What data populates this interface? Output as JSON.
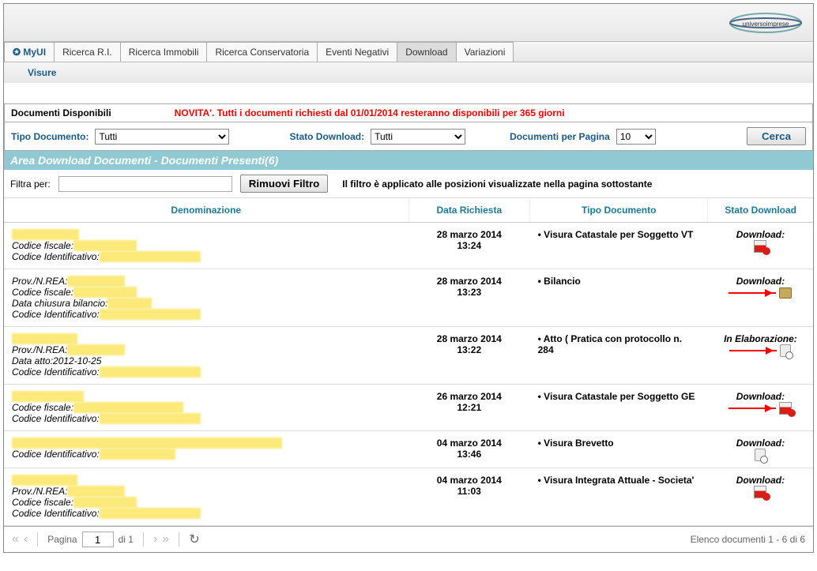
{
  "logo_text": "universoimprese",
  "tabs": [
    "MyUI",
    "Ricerca R.I.",
    "Ricerca Immobili",
    "Ricerca Conservatoria",
    "Eventi Negativi",
    "Download",
    "Variazioni"
  ],
  "active_tab_index": 5,
  "subtab": "Visure",
  "section_title": "Documenti Disponibili",
  "notice": "NOVITA'. Tutti i documenti richiesti dal 01/01/2014 resteranno disponibili per 365 giorni",
  "filters": {
    "tipo_label": "Tipo Documento:",
    "tipo_value": "Tutti",
    "stato_label": "Stato Download:",
    "stato_value": "Tutti",
    "perpage_label": "Documenti per Pagina",
    "perpage_value": "10",
    "search_btn": "Cerca"
  },
  "area_header": "Area Download Documenti - Documenti Presenti(6)",
  "filter_bar": {
    "label": "Filtra per:",
    "remove_btn": "Rimuovi Filtro",
    "note": "Il filtro è applicato alle posizioni visualizzate nella pagina sottostante"
  },
  "columns": {
    "denom": "Denominazione",
    "date": "Data Richiesta",
    "tipo": "Tipo Documento",
    "stato": "Stato Download"
  },
  "rows": [
    {
      "lines": [
        {
          "redact": "XXXXXX X.X.X."
        },
        {
          "label": "Codice fiscale:",
          "redact": "XXXXXXXXXX"
        },
        {
          "label": "Codice Identificativo:",
          "redact": "XXXXXXXXXXXXXXXX"
        }
      ],
      "date1": "28 marzo 2014",
      "date2": "13:24",
      "tipo": "Visura Catastale per Soggetto VT",
      "status": "Download:",
      "icon": "pdf",
      "arrow": false
    },
    {
      "lines": [
        {
          "label": "Prov./N.REA:",
          "redact": "XXXXXXXXX"
        },
        {
          "label": "Codice fiscale:",
          "redact": "XXXXXXXXXX"
        },
        {
          "label": "Data chiusura bilancio:",
          "redact": "XXXXXXX"
        },
        {
          "label": "Codice Identificativo:",
          "redact": "XXXXXXXXXXXXXXXX"
        }
      ],
      "date1": "28 marzo 2014",
      "date2": "13:23",
      "tipo": "Bilancio",
      "status": "Download:",
      "icon": "zip",
      "arrow": true
    },
    {
      "lines": [
        {
          "redact": "XXXXXXX XXX"
        },
        {
          "label": "Prov./N.REA:",
          "redact": "XXXXXXXXX"
        },
        {
          "label_full": "Data atto:2012-10-25"
        },
        {
          "label": "Codice Identificativo:",
          "redact": "XXXXXXXXXXXXXXXX"
        }
      ],
      "date1": "28 marzo 2014",
      "date2": "13:22",
      "tipo": "Atto ( Pratica con protocollo n. 284",
      "status": "In Elaborazione:",
      "icon": "proc",
      "arrow": true
    },
    {
      "lines": [
        {
          "redact": "XXXXXXX XXXX"
        },
        {
          "label": "Codice fiscale:",
          "redact": "XXXX XXXXXXXXXXXXX"
        },
        {
          "label": "Codice Identificativo:",
          "redact": "XXXXXXXXXXXXXXXX"
        }
      ],
      "date1": "26 marzo 2014",
      "date2": "12:21",
      "tipo": "Visura Catastale per Soggetto GE",
      "status": "Download:",
      "icon": "pdf",
      "arrow": true
    },
    {
      "lines": [
        {
          "redact_long": "AXXXXXXXX XXX XXXXXXXX XXXXXXXX XXXXXXXXXXXXX"
        },
        {
          "label": "Codice Identificativo:",
          "redact": "XXXXXXXXXXXX"
        }
      ],
      "date1": "04 marzo 2014",
      "date2": "13:46",
      "tipo": "Visura Brevetto",
      "status": "Download:",
      "icon": "proc",
      "arrow": false
    },
    {
      "lines": [
        {
          "redact": "XXXXXXX XXX"
        },
        {
          "label": "Prov./N.REA:",
          "redact": "XXXXXXXXX"
        },
        {
          "label": "Codice fiscale:",
          "redact": "XXXXXXXXXX"
        },
        {
          "label": "Codice Identificativo:",
          "redact": "XXXXXXXXXXXXXXXX"
        }
      ],
      "date1": "04 marzo 2014",
      "date2": "11:03",
      "tipo": "Visura Integrata Attuale - Societa'",
      "status": "Download:",
      "icon": "pdf",
      "arrow": false
    }
  ],
  "pager": {
    "page_label": "Pagina",
    "page_value": "1",
    "of_label": "di 1",
    "summary": "Elenco documenti 1 - 6 di 6"
  }
}
